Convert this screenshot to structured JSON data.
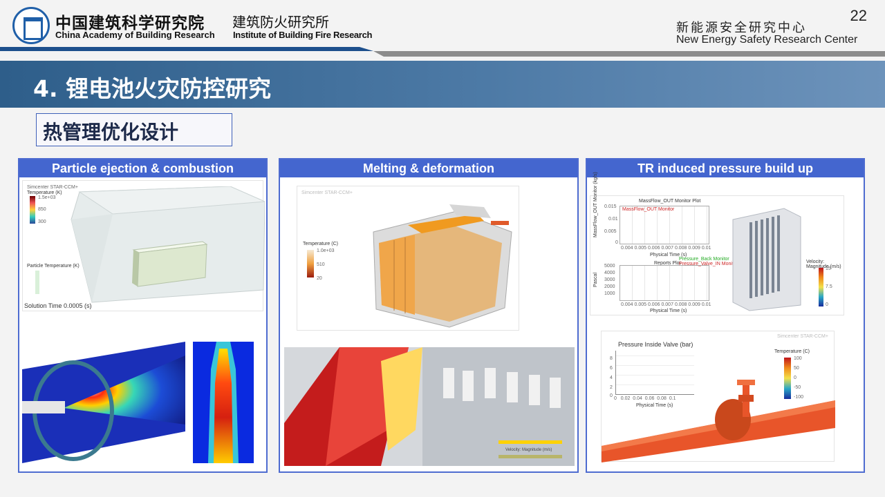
{
  "header": {
    "org_cn": "中国建筑科学研究院",
    "org_en": "China Academy of Building Research",
    "inst_cn": "建筑防火研究所",
    "inst_en": "Institute of Building Fire Research",
    "center_cn": "新能源安全研究中心",
    "center_en": "New Energy Safety Research Center",
    "page_number": "22"
  },
  "title": "4. 锂电池火灾防控研究",
  "subtitle": "热管理优化设计",
  "panels": [
    {
      "heading": "Particle ejection & combustion",
      "sim_label": "Simcenter STAR-CCM+",
      "legend1_title": "Temperature (K)",
      "legend1_ticks": [
        "1.5e+03",
        "850",
        "300"
      ],
      "legend2_title": "Particle Temperature (K)",
      "solution_time": "Solution Time 0.0005 (s)"
    },
    {
      "heading": "Melting & deformation",
      "sim_label": "Simcenter STAR-CCM+",
      "legend_title": "Temperature (C)",
      "legend_ticks": [
        "1.0e+03",
        "510",
        "20"
      ],
      "bottom_legend": "Velocity: Magnitude (m/s)"
    },
    {
      "heading": "TR induced pressure build up",
      "plot1_title": "MassFlow_OUT Monitor Plot",
      "plot1_ylabel": "MassFlow_OUT Monitor (kg/s)",
      "plot1_yticks": [
        "0.015",
        "0.01",
        "0.005",
        "0"
      ],
      "plot1_legend": "MassFlow_OUT Monitor",
      "plot2_title": "Reports Plot",
      "plot2_ylabel": "Pascal",
      "plot2_yticks": [
        "5000",
        "4000",
        "3000",
        "2000",
        "1000"
      ],
      "plot2_legend": [
        "Pressure_Back Monitor",
        "Pressure_Valve_IN Monitor"
      ],
      "xticks": [
        "0.004",
        "0.005",
        "0.006",
        "0.007",
        "0.008",
        "0.009",
        "0.01"
      ],
      "xlabel": "Physical Time (s)",
      "vel_legend": "Velocity: Magnitude (m/s)",
      "vel_ticks": [
        "15",
        "7.5",
        "0"
      ],
      "valve_title": "Pressure Inside Valve (bar)",
      "valve_yticks": [
        "8",
        "6",
        "4",
        "2",
        "0"
      ],
      "valve_xticks": [
        "0",
        "0.02",
        "0.04",
        "0.06",
        "0.08",
        "0.1"
      ],
      "valve_xlabel": "Physical Time (s)",
      "sim_label": "Simcenter STAR-CCM+",
      "temp_legend": "Temperature (C)",
      "temp_ticks": [
        "100",
        "50",
        "0",
        "-50",
        "-100"
      ]
    }
  ]
}
